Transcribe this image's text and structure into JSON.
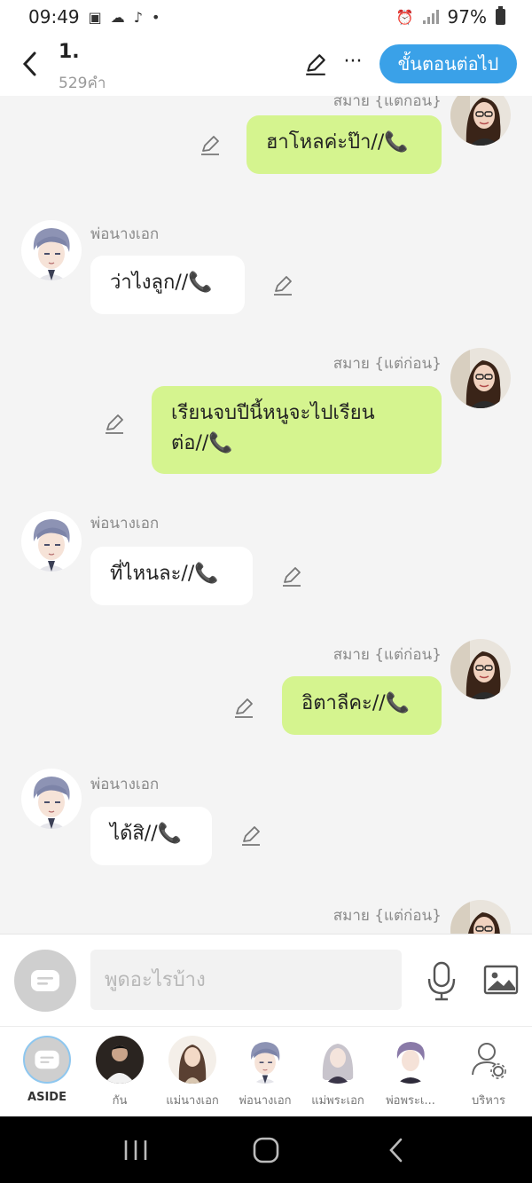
{
  "status": {
    "time": "09:49",
    "battery": "97%"
  },
  "header": {
    "title": "1.",
    "word_count": "529คำ",
    "next_label": "ขั้นตอนต่อไป"
  },
  "messages": [
    {
      "side": "right",
      "name": "สมาย {แต่ก่อน}",
      "text": "ฮาโหลค่ะป๊า//"
    },
    {
      "side": "left",
      "name": "พ่อนางเอก",
      "text": "ว่าไงลูก//"
    },
    {
      "side": "right",
      "name": "สมาย {แต่ก่อน}",
      "text_line1": "เรียนจบปีนี้หนูจะไปเรียน",
      "text_line2": "ต่อ//"
    },
    {
      "side": "left",
      "name": "พ่อนางเอก",
      "text": "ที่ไหนละ//"
    },
    {
      "side": "right",
      "name": "สมาย {แต่ก่อน}",
      "text": "อิตาลีคะ//"
    },
    {
      "side": "left",
      "name": "พ่อนางเอก",
      "text": "ได้สิ//"
    },
    {
      "side": "right",
      "name": "สมาย {แต่ก่อน}"
    }
  ],
  "input": {
    "placeholder": "พูดอะไรบ้าง"
  },
  "characters": [
    {
      "label": "ASIDE"
    },
    {
      "label": "กัน"
    },
    {
      "label": "แม่นางเอก"
    },
    {
      "label": "พ่อนางเอก"
    },
    {
      "label": "แม่พระเอก"
    },
    {
      "label": "พ่อพระเ..."
    },
    {
      "label": "บริหาร"
    }
  ],
  "colors": {
    "accent": "#3aa1e8",
    "right_bubble": "#d5f48f",
    "left_bubble": "#ffffff"
  }
}
